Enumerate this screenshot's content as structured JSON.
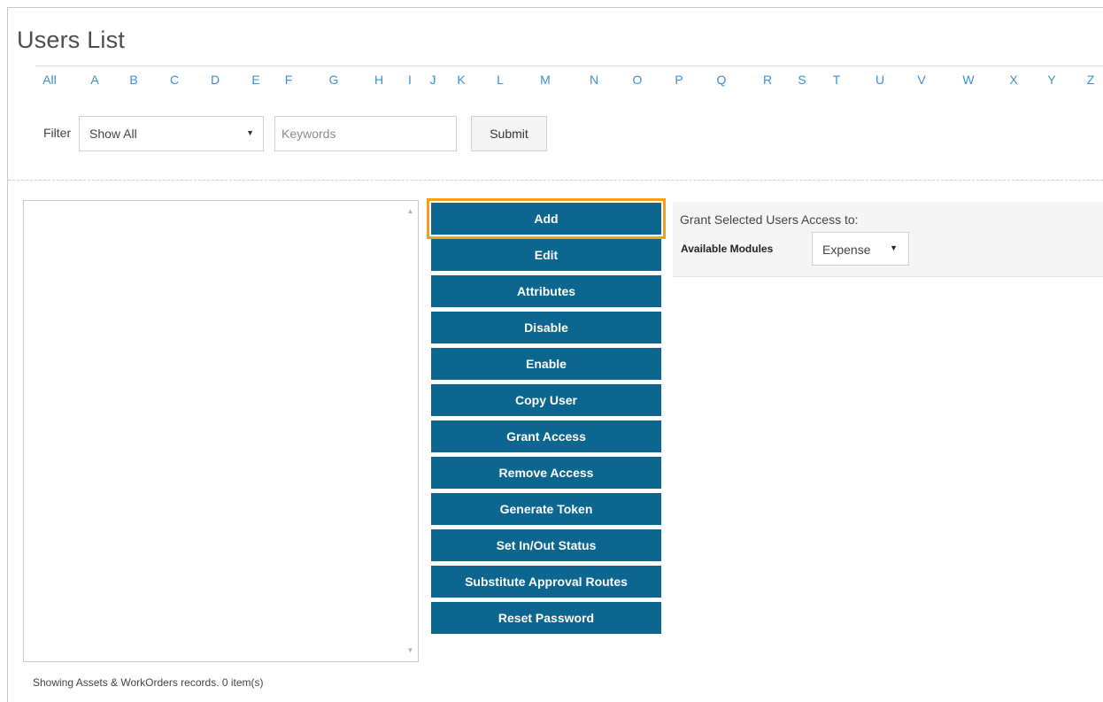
{
  "page_title": "Users List",
  "alphabet": [
    "All",
    "A",
    "B",
    "C",
    "D",
    "E",
    "F",
    "G",
    "H",
    "I",
    "J",
    "K",
    "L",
    "M",
    "N",
    "O",
    "P",
    "Q",
    "R",
    "S",
    "T",
    "U",
    "V",
    "W",
    "X",
    "Y",
    "Z"
  ],
  "filter": {
    "label": "Filter",
    "selected": "Show All",
    "keywords_placeholder": "Keywords",
    "submit_label": "Submit"
  },
  "actions": [
    "Add",
    "Edit",
    "Attributes",
    "Disable",
    "Enable",
    "Copy User",
    "Grant Access",
    "Remove Access",
    "Generate Token",
    "Set In/Out Status",
    "Substitute Approval Routes",
    "Reset Password"
  ],
  "highlighted_action": "Add",
  "grant_panel": {
    "title": "Grant Selected Users Access to:",
    "modules_label": "Available Modules",
    "modules_selected": "Expense"
  },
  "status_text": "Showing Assets & WorkOrders records. 0 item(s)",
  "colors": {
    "button_bg": "#0d668f",
    "highlight_outline": "#f29f1f",
    "link": "#3b8fd0"
  },
  "icons": {
    "dropdown_caret": "chevron-down-icon",
    "scroll_up": "scroll-up-arrow-icon",
    "scroll_down": "scroll-down-arrow-icon"
  }
}
